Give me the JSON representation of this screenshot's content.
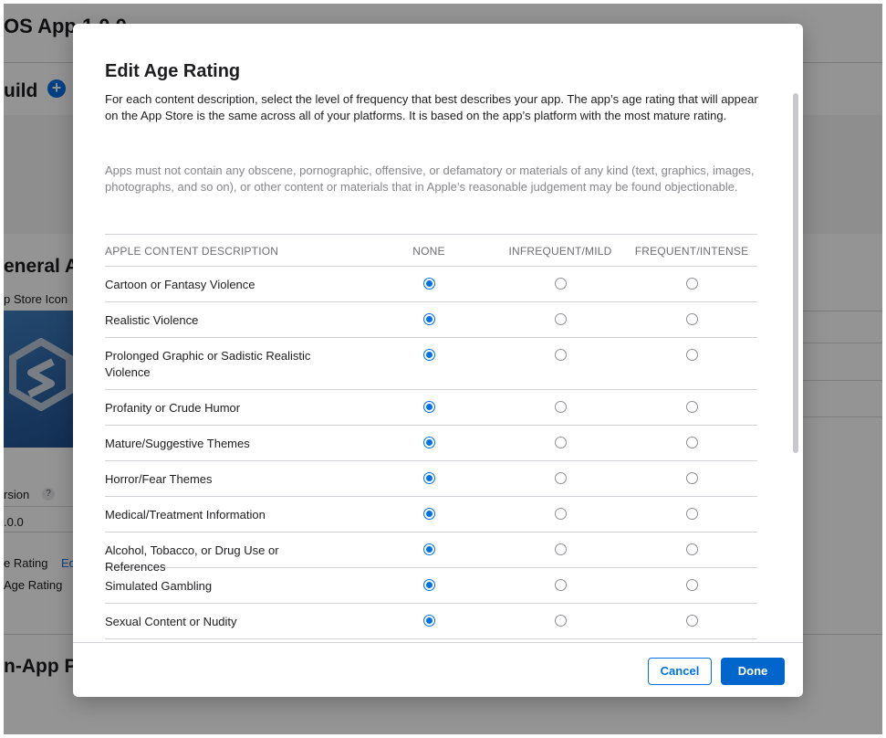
{
  "background": {
    "title": "OS App 1.0.0",
    "build_heading": "uild",
    "general_heading": "eneral A",
    "app_store_icon_label": "p Store Icon",
    "version_label": "rsion",
    "help_glyph": "?",
    "version_value": ".0.0",
    "age_rating_label": "e Rating",
    "edit_link": "Ed",
    "age_rating_value": "Age Rating",
    "in_app_heading": "n-App P"
  },
  "modal": {
    "title": "Edit Age Rating",
    "intro": "For each content description, select the level of frequency that best describes your app. The app’s age rating that will appear on the App Store is the same across all of your platforms. It is based on the app’s platform with the most mature rating.",
    "note": "Apps must not contain any obscene, pornographic, offensive, or defamatory or materials of any kind (text, graphics, images, photographs, and so on), or other content or materials that in Apple’s reasonable judgement may be found objectionable.",
    "table": {
      "headers": {
        "description": "APPLE CONTENT DESCRIPTION",
        "none": "NONE",
        "mild": "INFREQUENT/MILD",
        "intense": "FREQUENT/INTENSE"
      },
      "rows": [
        {
          "label": "Cartoon or Fantasy Violence",
          "selected": "none"
        },
        {
          "label": "Realistic Violence",
          "selected": "none"
        },
        {
          "label": "Prolonged Graphic or Sadistic Realistic Violence",
          "selected": "none"
        },
        {
          "label": "Profanity or Crude Humor",
          "selected": "none"
        },
        {
          "label": "Mature/Suggestive Themes",
          "selected": "none"
        },
        {
          "label": "Horror/Fear Themes",
          "selected": "none"
        },
        {
          "label": "Medical/Treatment Information",
          "selected": "none"
        },
        {
          "label": "Alcohol, Tobacco, or Drug Use or References",
          "selected": "none"
        },
        {
          "label": "Simulated Gambling",
          "selected": "none"
        },
        {
          "label": "Sexual Content or Nudity",
          "selected": "none"
        }
      ]
    },
    "footer": {
      "cancel_label": "Cancel",
      "done_label": "Done"
    }
  },
  "colors": {
    "accent": "#0071e3",
    "primary_button": "#0066cc",
    "divider": "#d2d2d7",
    "muted_text": "#86868b"
  }
}
